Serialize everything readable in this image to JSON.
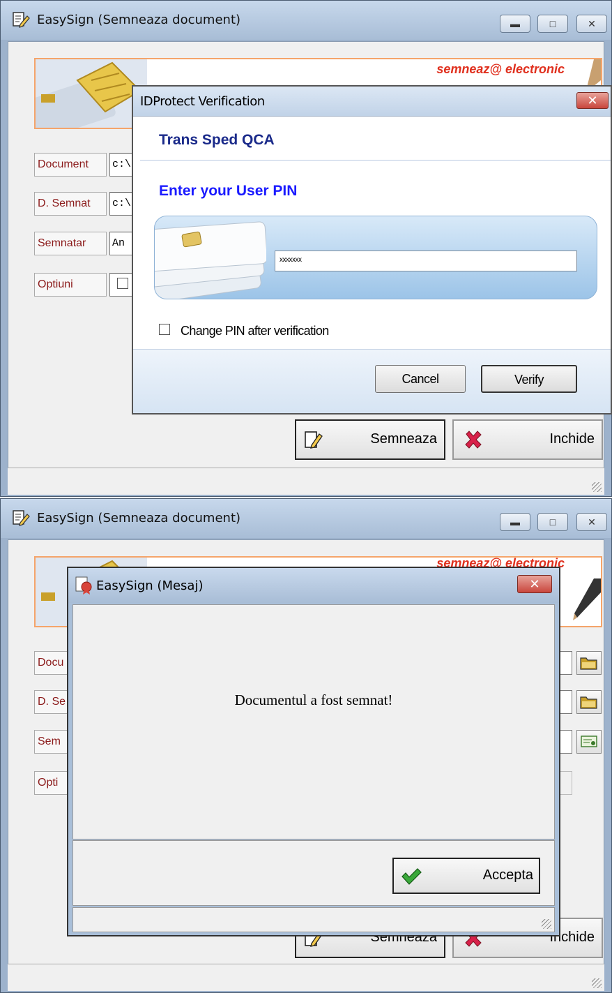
{
  "window1": {
    "title": "EasySign (Semneaza document)",
    "banner_tagline": "semneaz@ electronic",
    "fields": [
      {
        "label": "Document",
        "value": "c:\\"
      },
      {
        "label": "D. Semnat",
        "value": "c:\\"
      },
      {
        "label": "Semnatar",
        "value": "An"
      },
      {
        "label": "Optiuni",
        "value": ""
      }
    ],
    "sign_button": "Semneaza",
    "close_button": "Inchide"
  },
  "pin_dialog": {
    "title": "IDProtect Verification",
    "provider": "Trans Sped QCA",
    "prompt": "Enter your User PIN",
    "pin_value": "xxxxxxx",
    "change_pin_label": "Change PIN after verification",
    "change_pin_checked": false,
    "cancel_label": "Cancel",
    "verify_label": "Verify"
  },
  "window2": {
    "title": "EasySign (Semneaza document)",
    "banner_tagline": "semneaz@ electronic",
    "fields": [
      {
        "label": "Docu"
      },
      {
        "label": "D. Se"
      },
      {
        "label": "Sem"
      },
      {
        "label": "Opti"
      }
    ],
    "sign_button": "Semneaza",
    "close_button": "Inchide"
  },
  "message_dialog": {
    "title": "EasySign (Mesaj)",
    "message": "Documentul a fost semnat!",
    "accept_label": "Accepta"
  },
  "colors": {
    "label_text": "#8b1a1a",
    "banner_border": "#f5a46a",
    "tagline": "#e0301e",
    "dialog_heading": "#1a2a8a",
    "dialog_prompt": "#1a1aff",
    "close_red": "#c9463d"
  },
  "icons": [
    "app-edit-icon",
    "minimize-icon",
    "maximize-icon",
    "close-icon",
    "smartcard-icon",
    "sign-pen-icon",
    "cross-icon",
    "checkmark-icon",
    "folder-icon",
    "certificate-icon",
    "message-seal-icon"
  ]
}
